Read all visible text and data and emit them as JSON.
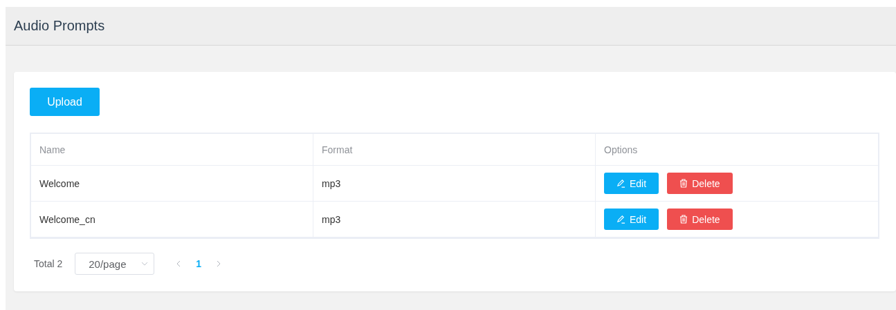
{
  "header": {
    "title": "Audio Prompts"
  },
  "toolbar": {
    "upload_label": "Upload"
  },
  "table": {
    "columns": [
      "Name",
      "Format",
      "Options"
    ],
    "rows": [
      {
        "name": "Welcome",
        "format": "mp3",
        "actions": [
          {
            "kind": "edit",
            "label": "Edit"
          },
          {
            "kind": "delete",
            "label": "Delete"
          }
        ]
      },
      {
        "name": "Welcome_cn",
        "format": "mp3",
        "actions": [
          {
            "kind": "edit",
            "label": "Edit"
          },
          {
            "kind": "delete",
            "label": "Delete"
          }
        ]
      }
    ]
  },
  "pagination": {
    "total": "Total 2",
    "page_size": "20/page",
    "pages": [
      {
        "label": "1",
        "selected": true
      }
    ]
  }
}
